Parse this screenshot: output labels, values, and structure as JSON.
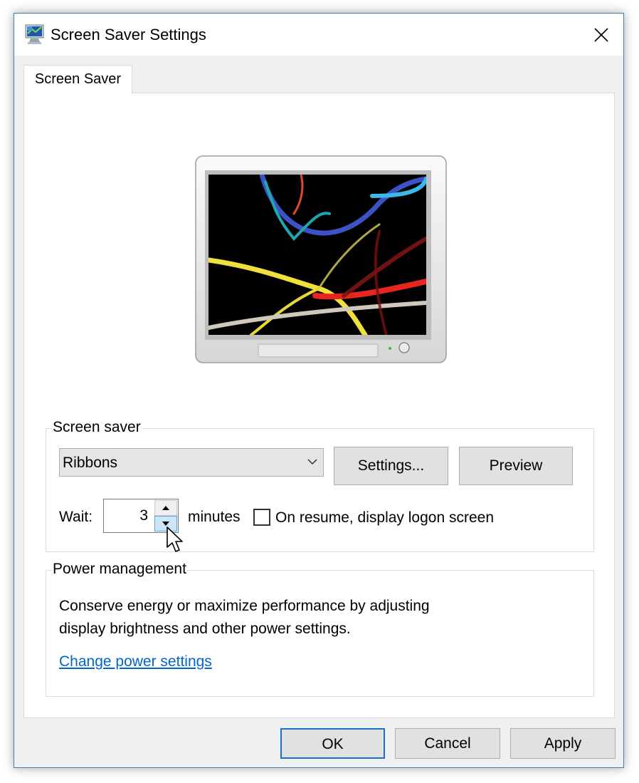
{
  "window": {
    "title": "Screen Saver Settings",
    "accent_color": "#3c7fb1"
  },
  "tabs": [
    {
      "label": "Screen Saver",
      "active": true
    }
  ],
  "screen_saver": {
    "group_label": "Screen saver",
    "selected": "Ribbons",
    "settings_label": "Settings...",
    "preview_label": "Preview",
    "wait_label": "Wait:",
    "wait_value": "3",
    "minutes_label": "minutes",
    "logon_label": "On resume, display logon screen",
    "logon_checked": false
  },
  "power": {
    "group_label": "Power management",
    "description_line1": "Conserve energy or maximize performance by adjusting",
    "description_line2": "display brightness and other power settings.",
    "link_label": "Change power settings",
    "link_color": "#0066cc"
  },
  "footer": {
    "ok_label": "OK",
    "cancel_label": "Cancel",
    "apply_label": "Apply"
  },
  "icons": {
    "title": "screen-saver-monitor-icon",
    "close": "close-icon",
    "dropdown": "chevron-down-icon",
    "spin_up": "arrow-up-icon",
    "spin_down": "arrow-down-icon",
    "cursor": "mouse-pointer-icon"
  }
}
